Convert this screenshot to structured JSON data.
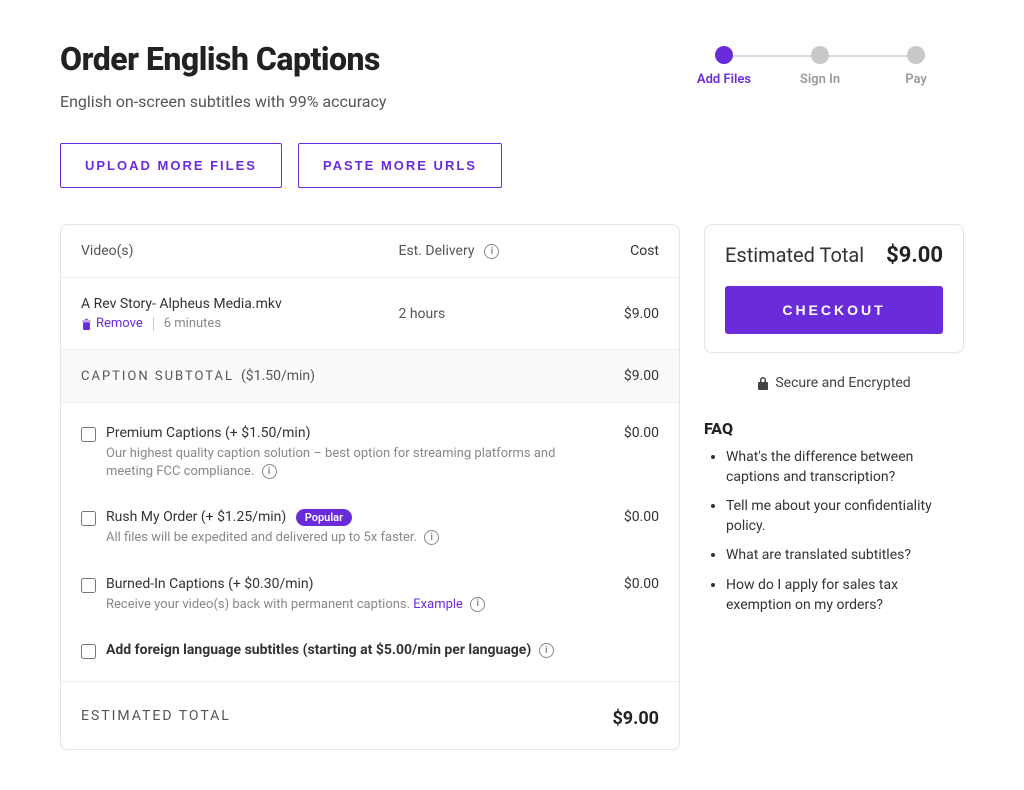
{
  "page": {
    "title": "Order English Captions",
    "subtitle": "English on-screen subtitles with 99% accuracy"
  },
  "stepper": {
    "steps": [
      {
        "label": "Add Files",
        "active": true
      },
      {
        "label": "Sign In",
        "active": false
      },
      {
        "label": "Pay",
        "active": false
      }
    ]
  },
  "actions": {
    "upload": "UPLOAD MORE FILES",
    "paste": "PASTE MORE URLS"
  },
  "table": {
    "headers": {
      "videos": "Video(s)",
      "delivery": "Est. Delivery",
      "cost": "Cost"
    },
    "file": {
      "name": "A Rev Story- Alpheus Media.mkv",
      "remove_label": "Remove",
      "duration": "6 minutes",
      "delivery": "2 hours",
      "cost": "$9.00"
    },
    "subtotal": {
      "label": "CAPTION SUBTOTAL",
      "rate": "($1.50/min)",
      "value": "$9.00"
    }
  },
  "options": {
    "premium": {
      "title": "Premium Captions (+ $1.50/min)",
      "desc": "Our highest quality caption solution – best option for streaming platforms and meeting FCC compliance.",
      "cost": "$0.00"
    },
    "rush": {
      "title": "Rush My Order (+ $1.25/min)",
      "badge": "Popular",
      "desc": "All files will be expedited and delivered up to 5x faster.",
      "cost": "$0.00"
    },
    "burned": {
      "title": "Burned-In Captions (+ $0.30/min)",
      "desc": "Receive your video(s) back with permanent captions.",
      "example": "Example",
      "cost": "$0.00"
    },
    "foreign": {
      "title": "Add foreign language subtitles (starting at $5.00/min per language)"
    }
  },
  "totals": {
    "estimated_label": "ESTIMATED TOTAL",
    "estimated_value": "$9.00"
  },
  "sidebar": {
    "total_label": "Estimated Total",
    "total_value": "$9.00",
    "checkout": "CHECKOUT",
    "secure": "Secure and Encrypted"
  },
  "faq": {
    "heading": "FAQ",
    "items": [
      "What's the difference between captions and transcription?",
      "Tell me about your confidentiality policy.",
      "What are translated subtitles?",
      "How do I apply for sales tax exemption on my orders?"
    ]
  }
}
